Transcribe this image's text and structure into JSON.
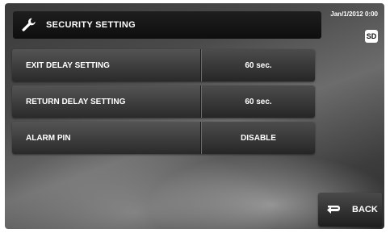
{
  "header": {
    "title": "SECURITY SETTING",
    "icon": "wrench-icon"
  },
  "status": {
    "datetime": "Jan/1/2012 0:00",
    "sd_badge": "SD"
  },
  "settings": [
    {
      "label": "EXIT DELAY SETTING",
      "value": "60 sec."
    },
    {
      "label": "RETURN DELAY SETTING",
      "value": "60 sec."
    },
    {
      "label": "ALARM PIN",
      "value": "DISABLE"
    }
  ],
  "back_button": {
    "label": "BACK",
    "icon": "return-arrow-icon"
  }
}
